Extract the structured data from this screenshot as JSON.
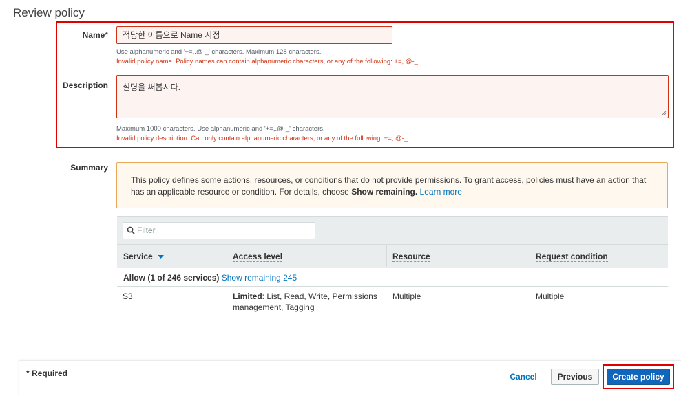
{
  "page": {
    "title": "Review policy"
  },
  "name_field": {
    "label": "Name",
    "required_mark": "*",
    "value": "적당한 이름으로 Name 지정",
    "hint": "Use alphanumeric and '+=,.@-_' characters. Maximum 128 characters.",
    "error": "Invalid policy name. Policy names can contain alphanumeric characters, or any of the following: +=,.@-_"
  },
  "description_field": {
    "label": "Description",
    "value": "설명을 써봅시다.",
    "hint": "Maximum 1000 characters. Use alphanumeric and '+=,.@-_' characters.",
    "error": "Invalid policy description. Can only contain alphanumeric characters, or any of the following: +=,.@-_"
  },
  "summary": {
    "label": "Summary",
    "alert_text_1": "This policy defines some actions, resources, or conditions that do not provide permissions. To grant access, policies must have an action that has an applicable resource or condition. For details, choose ",
    "alert_bold": "Show remaining.",
    "alert_link": "Learn more",
    "filter_placeholder": "Filter",
    "columns": [
      "Service",
      "Access level",
      "Resource",
      "Request condition"
    ],
    "group_label": "Allow (1 of 246 services)",
    "group_link": "Show remaining 245",
    "rows": [
      {
        "service": "S3",
        "access_bold": "Limited",
        "access_rest": ": List, Read, Write, Permissions management, Tagging",
        "resource": "Multiple",
        "condition": "Multiple"
      }
    ]
  },
  "footer": {
    "required_note": "* Required",
    "cancel": "Cancel",
    "previous": "Previous",
    "create": "Create policy"
  },
  "colors": {
    "highlight": "#e00000",
    "error": "#d13212",
    "link": "#0073bb",
    "primary": "#1066bb",
    "alert_border": "#e8a85a"
  }
}
